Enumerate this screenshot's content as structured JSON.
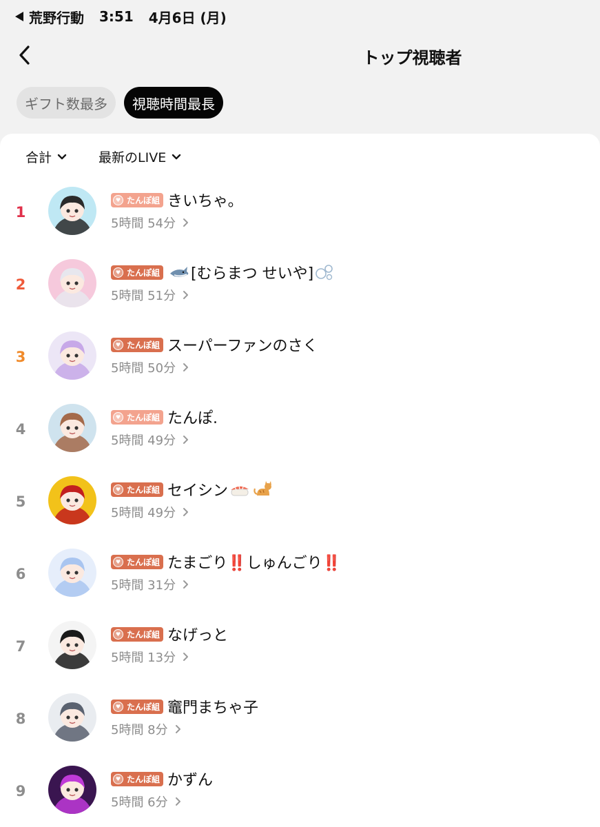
{
  "status_bar": {
    "back_app": "荒野行動",
    "time": "3:51",
    "date": "4月6日 (月)"
  },
  "header": {
    "title": "トップ視聴者",
    "back_icon": "chevron-left-icon"
  },
  "tabs": [
    {
      "label": "ギフト数最多",
      "active": false
    },
    {
      "label": "視聴時間最長",
      "active": true
    }
  ],
  "filters": [
    {
      "label": "合計",
      "icon": "chevron-down-icon"
    },
    {
      "label": "最新のLIVE",
      "icon": "chevron-down-icon"
    }
  ],
  "badge_text": "たんぽ組",
  "colors": {
    "rank1": "#e0304a",
    "rank2": "#ef5a3a",
    "rank3": "#f08a2a",
    "rank_other": "#8d8d8d",
    "badge_light": "#f3a38e",
    "badge_dark": "#d96f4e",
    "active_tab_bg": "#050505"
  },
  "viewers": [
    {
      "rank": "1",
      "name": "きいちゃ。",
      "emojis": [],
      "duration": "5時間 54分",
      "badge_style": "light",
      "avatar_bg": "#bfe8f4",
      "avatar_fg": "#2a2a2a"
    },
    {
      "rank": "2",
      "name": "[むらまつ せいや]",
      "emojis": [
        "shark-emoji",
        "bubbles-emoji"
      ],
      "duration": "5時間 51分",
      "badge_style": "dark",
      "avatar_bg": "#f6c9dc",
      "avatar_fg": "#e7e7ee"
    },
    {
      "rank": "3",
      "name": "スーパーファンのさく",
      "emojis": [],
      "duration": "5時間 50分",
      "badge_style": "dark",
      "avatar_bg": "#ece6f6",
      "avatar_fg": "#c7a8e8"
    },
    {
      "rank": "4",
      "name": "たんぽ.",
      "emojis": [],
      "duration": "5時間 49分",
      "badge_style": "light",
      "avatar_bg": "#cfe3ee",
      "avatar_fg": "#a46a4a"
    },
    {
      "rank": "5",
      "name": "セイシン",
      "emojis": [
        "sushi-emoji",
        "cat-emoji"
      ],
      "duration": "5時間 49分",
      "badge_style": "dark",
      "avatar_bg": "#f2c21a",
      "avatar_fg": "#c21f1f"
    },
    {
      "rank": "6",
      "name": "たまごり‼️しゅんごり‼️",
      "emojis": [],
      "duration": "5時間 31分",
      "badge_style": "dark",
      "avatar_bg": "#e6eefb",
      "avatar_fg": "#a9c5f0"
    },
    {
      "rank": "7",
      "name": "なげっと",
      "emojis": [],
      "duration": "5時間 13分",
      "badge_style": "dark",
      "avatar_bg": "#f4f4f4",
      "avatar_fg": "#1a1a1a"
    },
    {
      "rank": "8",
      "name": "竈門まちゃ子",
      "emojis": [],
      "duration": "5時間 8分",
      "badge_style": "dark",
      "avatar_bg": "#e9ecf0",
      "avatar_fg": "#5a6270"
    },
    {
      "rank": "9",
      "name": "かずん",
      "emojis": [],
      "duration": "5時間 6分",
      "badge_style": "dark",
      "avatar_bg": "#3a1550",
      "avatar_fg": "#c03ad8"
    }
  ]
}
